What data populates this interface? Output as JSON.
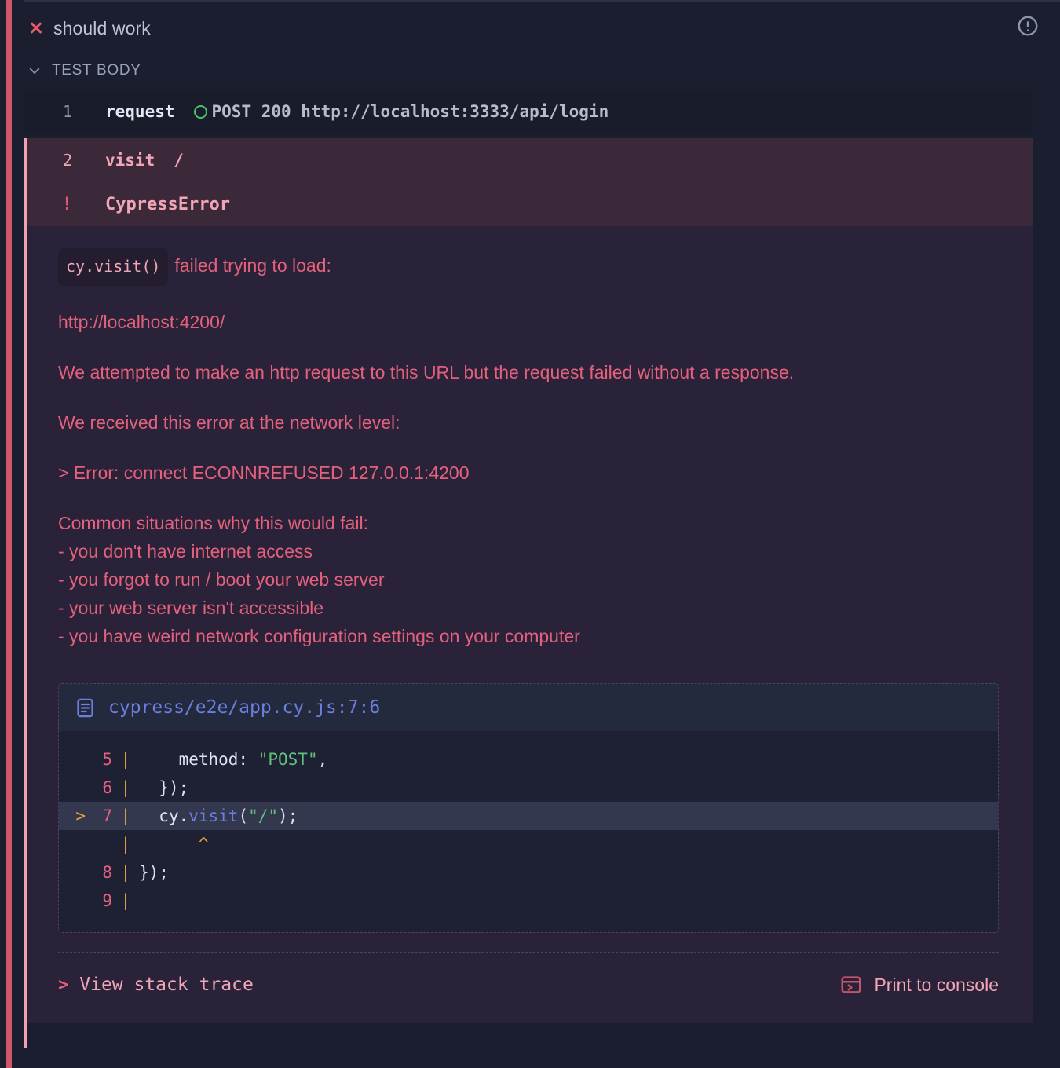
{
  "window": {
    "background": "#1b1e2e",
    "fail_accent": "#d0566c"
  },
  "test": {
    "status_icon": "x-icon",
    "title": "should work",
    "alert_icon": "alert-circle-icon"
  },
  "test_body": {
    "toggle_icon": "chevron-down-icon",
    "label": "TEST BODY",
    "commands": [
      {
        "number": "1",
        "name": "request",
        "status_icon": "status-circle-icon",
        "message": "POST 200 http://localhost:3333/api/login",
        "state": "ok"
      },
      {
        "number": "2",
        "name": "visit",
        "status_icon": "",
        "message": "/",
        "state": "fail"
      }
    ]
  },
  "error": {
    "marker": "!",
    "kind": "CypressError",
    "chip": "cy.visit()",
    "headline_rest": "failed trying to load:",
    "url": "http://localhost:4200/",
    "paragraph_1": "We attempted to make an http request to this URL but the request failed without a response.",
    "paragraph_2": "We received this error at the network level:",
    "network_error": "> Error: connect ECONNREFUSED 127.0.0.1:4200",
    "bullets_title": "Common situations why this would fail:",
    "bullets": [
      "- you don't have internet access",
      "- you forgot to run / boot your web server",
      "- your web server isn't accessible",
      "- you have weird network configuration settings on your computer"
    ],
    "text_color": "#e4617d"
  },
  "code_frame": {
    "file_icon": "file-document-icon",
    "path": "cypress/e2e/app.cy.js:7:6",
    "lines": [
      {
        "marker": "",
        "num": "5",
        "pipe": "|",
        "indent": "    ",
        "pre": "method: ",
        "str": "\"POST\"",
        "post": ",",
        "highlight": false
      },
      {
        "marker": "",
        "num": "6",
        "pipe": "|",
        "indent": "  ",
        "pre": "});",
        "str": "",
        "post": "",
        "highlight": false
      },
      {
        "marker": ">",
        "num": "7",
        "pipe": "|",
        "indent": "  ",
        "pre": "cy.",
        "fn": "visit",
        "paren_open": "(",
        "str": "\"/\"",
        "post": ");",
        "highlight": true
      },
      {
        "marker": "",
        "num": "",
        "pipe": "|",
        "indent": "      ",
        "caret": "^",
        "highlight": false
      },
      {
        "marker": "",
        "num": "8",
        "pipe": "|",
        "indent": "",
        "pre": "});",
        "str": "",
        "post": "",
        "highlight": false
      },
      {
        "marker": "",
        "num": "9",
        "pipe": "|",
        "indent": "",
        "pre": "",
        "str": "",
        "post": "",
        "highlight": false
      }
    ]
  },
  "footer": {
    "stack_toggle_chevron": ">",
    "stack_toggle_label": "View stack trace",
    "console_icon": "console-window-icon",
    "print_label": "Print to console"
  }
}
